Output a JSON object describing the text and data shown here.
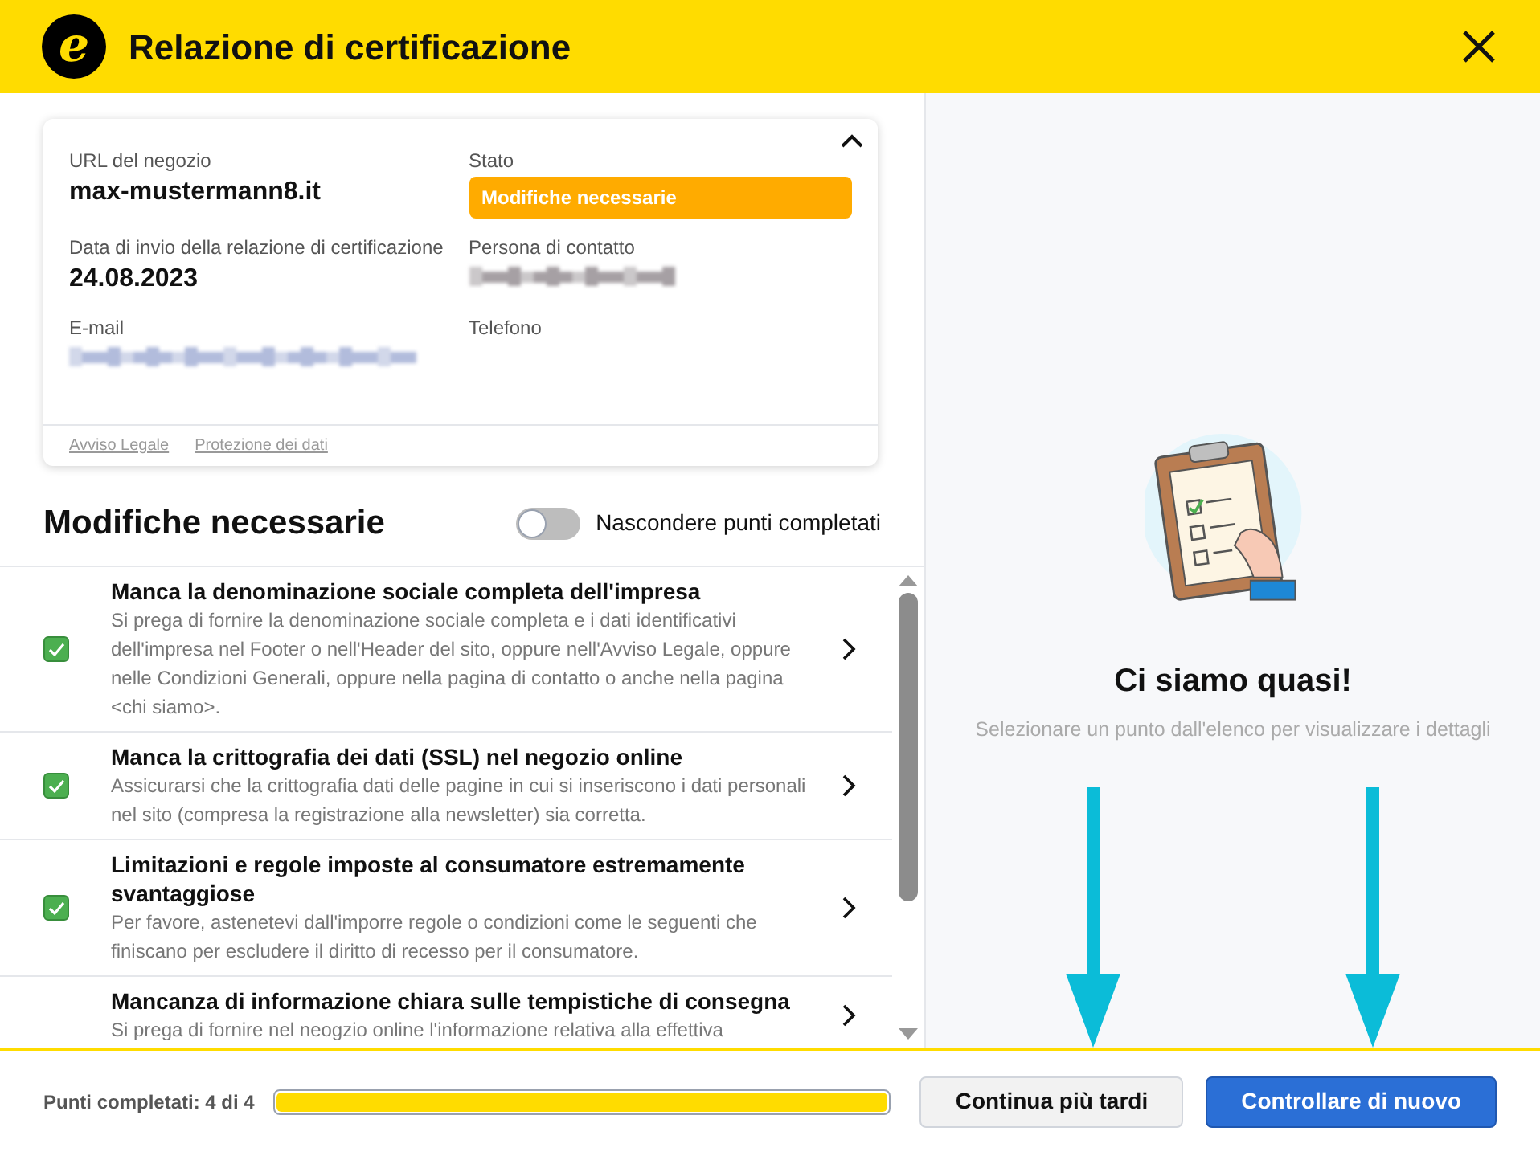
{
  "window": {
    "title": "Relazione di certificazione",
    "logo": "e"
  },
  "summary": {
    "expanded": true,
    "fields": [
      {
        "label": "URL del negozio",
        "value": "max-mustermann8.it"
      },
      {
        "label": "Stato",
        "badge": "Modifiche necessarie",
        "color": "#ffab00"
      },
      {
        "label": "Data di invio della relazione di certificazione",
        "value": "24.08.2023"
      },
      {
        "label": "Persona di contatto",
        "redacted": true
      },
      {
        "label": "E-mail",
        "redacted": true
      },
      {
        "label": "Telefono"
      }
    ],
    "links": [
      "Avviso Legale",
      "Protezione dei dati"
    ]
  },
  "section": {
    "title": "Modifiche necessarie",
    "toggle": {
      "label": "Nascondere punti completati",
      "on": false
    }
  },
  "items": [
    {
      "title": "Manca la denominazione sociale completa dell'impresa",
      "description": "Si prega di fornire la denominazione sociale completa e i dati identificativi dell'impresa nel Footer o nell'Header del sito, oppure nell'Avviso Legale, oppure nelle Condizioni Generali, oppure nella pagina di contatto o anche nella pagina <chi siamo>.",
      "checked": true
    },
    {
      "title": "Manca la crittografia dei dati (SSL) nel negozio online",
      "description": "Assicurarsi che la crittografia dati delle pagine in cui si inseriscono i dati personali nel sito (compresa la registrazione alla newsletter) sia corretta.",
      "checked": true
    },
    {
      "title": "Limitazioni e regole imposte al consumatore estremamente svantaggiose",
      "description": "Per favore, astenetevi dall'imporre regole o condizioni come le seguenti che finiscano per escludere il diritto di recesso per il consumatore.",
      "checked": true
    },
    {
      "title": "Mancanza di informazione chiara sulle tempistiche di consegna",
      "description": "Si prega di fornire nel neogzio online l'informazione relativa alla effettiva"
    }
  ],
  "detail": {
    "title": "Ci siamo quasi!",
    "hint": "Selezionare un punto dall'elenco per visualizzare i dettagli"
  },
  "footer": {
    "progress_label": "Punti completati: 4 di 4",
    "level": 1,
    "buttons": [
      {
        "label": "Continua più tardi",
        "kind": "secondary"
      },
      {
        "label": "Controllare di nuovo",
        "kind": "primary"
      }
    ]
  }
}
